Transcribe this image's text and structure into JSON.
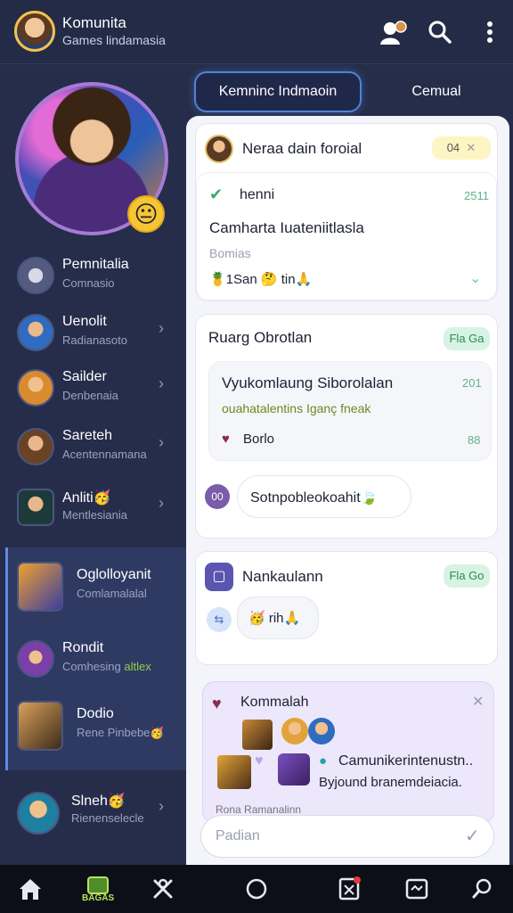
{
  "header": {
    "title": "Komunita",
    "subtitle": "Games lindamasia",
    "icons": [
      "group-icon",
      "search-icon",
      "more-vertical-icon"
    ]
  },
  "sidebar": {
    "hero_emoji": "😐",
    "items": [
      {
        "name": "Pemnitalia",
        "sub": "Comnasio"
      },
      {
        "name": "Uenolit",
        "sub": "Radianasoto"
      },
      {
        "name": "Sailder",
        "sub": "Denbenaia"
      },
      {
        "name": "Sareteh",
        "sub": "Acentennamana"
      },
      {
        "name": "Anliti🥳",
        "sub": "Mentlesiania"
      },
      {
        "name": "Oglolloyanit",
        "sub": "Comlamalalal"
      },
      {
        "name": "Rondit",
        "sub": "Comhesing",
        "sub_accent": "altlex"
      },
      {
        "name": "Dodio",
        "sub": "Rene Pinbebe🥳"
      },
      {
        "name": "Slneh🥳",
        "sub": "Rienenselecle"
      }
    ]
  },
  "tabs": [
    {
      "label": "Kemninc Indmaoin",
      "active": true
    },
    {
      "label": "Cemual",
      "active": false
    }
  ],
  "panel": {
    "card1": {
      "title": "Neraa dain foroial",
      "badge": "04",
      "post_user": "henni",
      "post_time": "2511",
      "post_body": "Camharta Iuateniitlasla",
      "post_tag": "Bomias",
      "post_reacts": "🍍1San 🤔 tin🙏"
    },
    "card2": {
      "title": "Ruarg Obrotlan",
      "badge": "Fla Ga",
      "quote_title": "Vyukomlaung Siborolalan",
      "quote_time": "201",
      "quote_sub": "ouahatalentins Iganç fneak",
      "quote_user": "Borlo",
      "quote_count": "88",
      "reply_av": "00",
      "reply_text": "Sotnpobleokoahit🍃"
    },
    "card3": {
      "title": "Nankaulann",
      "badge": "Fla Go",
      "reply_text": "🥳 rih🙏"
    },
    "card4": {
      "title": "Kommalah",
      "line1": "Camunikerintenustn..",
      "line2": "Byjound branemdeiacia.",
      "footer": "Rona Ramanalinn"
    },
    "input_placeholder": "Padian"
  },
  "bottom_nav": {
    "items": [
      "home-icon",
      "games-icon",
      "tools-icon",
      "circle-icon",
      "bookmark-icon",
      "media-icon",
      "search-icon"
    ],
    "games_label": "BAGAS"
  }
}
